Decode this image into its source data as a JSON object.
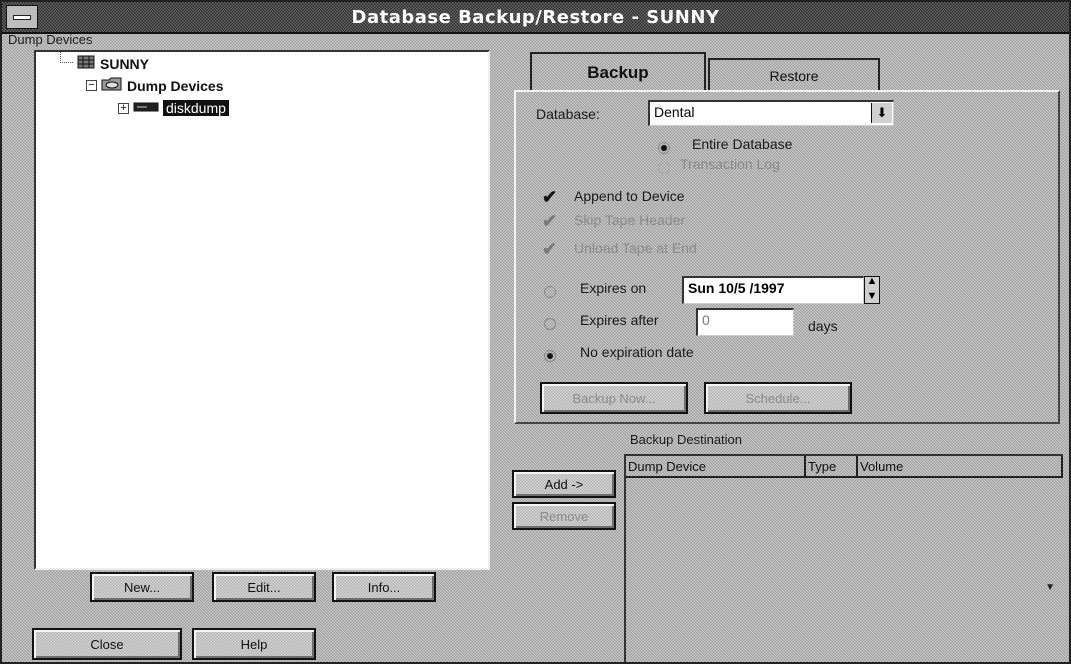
{
  "window": {
    "title": "Database Backup/Restore - SUNNY"
  },
  "left": {
    "group_label": "Dump Devices",
    "tree": [
      {
        "label": "SUNNY",
        "icon": "server-icon"
      },
      {
        "label": "Dump Devices",
        "icon": "folder-icon"
      },
      {
        "label": "diskdump",
        "icon": "disk-device-icon"
      }
    ],
    "buttons": {
      "new": "New...",
      "edit": "Edit...",
      "info": "Info..."
    }
  },
  "bottom_buttons": {
    "close": "Close",
    "help": "Help"
  },
  "tabs": {
    "backup": "Backup",
    "restore": "Restore"
  },
  "backup": {
    "database_label": "Database:",
    "database_value": "Dental",
    "entire_database": "Entire Database",
    "transaction_log": "Transaction Log",
    "append_to_device": "Append to Device",
    "skip_tape_header": "Skip Tape Header",
    "unload_tape": "Unload Tape at End",
    "expires_on_label": "Expires on",
    "expires_on_value": "Sun 10/5 /1997",
    "expires_after_label": "Expires after",
    "expires_after_value": "0",
    "days_label": "days",
    "no_expiration": "No expiration date",
    "backup_now": "Backup Now...",
    "schedule": "Schedule..."
  },
  "destination": {
    "label": "Backup Destination",
    "add": "Add ->",
    "remove": "Remove",
    "columns": [
      "Dump Device",
      "Type",
      "Volume"
    ]
  }
}
